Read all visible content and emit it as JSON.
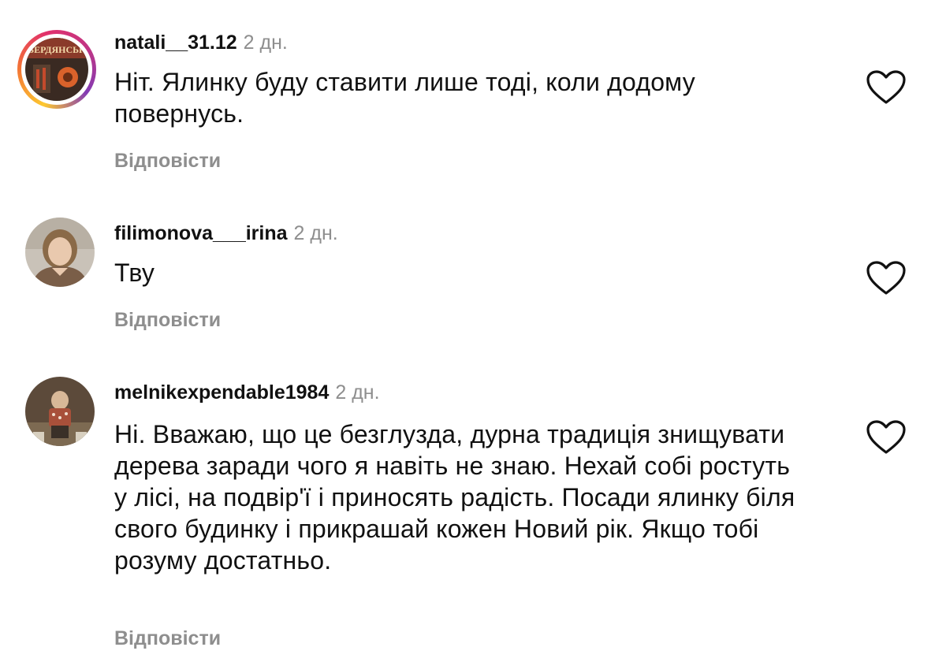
{
  "comments": [
    {
      "username": "natali__31.12",
      "time": "2 дн.",
      "text": "Ніт. Ялинку буду ставити лише тоді, коли додому повернусь.",
      "reply_label": "Відповісти",
      "avatar_text": "БЕРДЯНСЬК",
      "has_story_ring": true
    },
    {
      "username": "filimonova___irina",
      "time": "2 дн.",
      "text": "Тву",
      "reply_label": "Відповісти",
      "has_story_ring": false
    },
    {
      "username": "melnikexpendable1984",
      "time": "2 дн.",
      "text": "Ні. Вважаю, що це безглузда, дурна традиція знищувати дерева заради чого я навіть не знаю. Нехай собі ростуть у лісі, на подвір'ї і приносять радість. Посади ялинку біля свого будинку і прикрашай кожен Новий рік. Якщо тобі розуму достатньо.",
      "reply_label": "Відповісти",
      "has_story_ring": false
    }
  ],
  "icons": {
    "like": "heart-outline-icon"
  },
  "colors": {
    "muted_text": "#8e8e8e",
    "primary_text": "#111111",
    "story_ring": [
      "#fdc830",
      "#f37335",
      "#e1306c",
      "#833ab4"
    ]
  }
}
